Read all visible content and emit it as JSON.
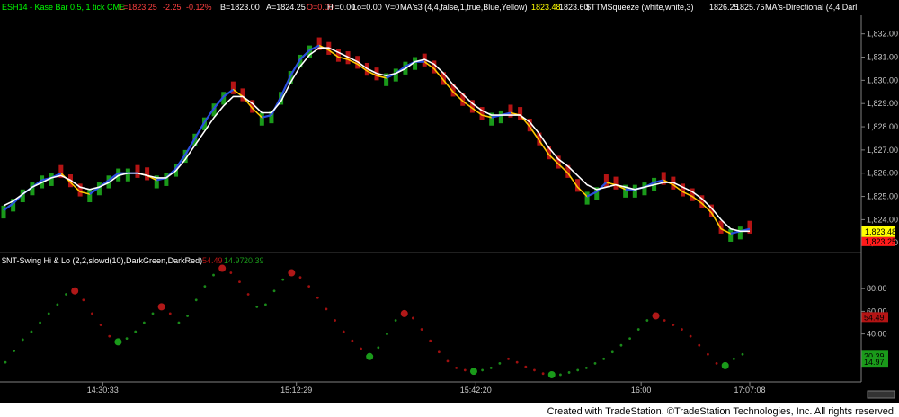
{
  "header": {
    "symbol": "ESH14 - Kase Bar 0.5, 1 tick  CME",
    "last": "L=1823.25",
    "change": "-2.25",
    "pct": "-0.12%",
    "bid": "B=1823.00",
    "ask": "A=1824.25",
    "open": "O=0.00",
    "hi": "Hi=0.00",
    "lo": "Lo=0.00",
    "vol": "V=0",
    "ma_label": "MA's3 (4,4,false,1,true,Blue,Yellow)",
    "ma_v1": "1823.48",
    "ma_v2": "1823.60",
    "ttm_label": "$TTMSqueeze (white,white,3)",
    "ttm_v1": "1826.25",
    "ttm_v2": "1825.75",
    "dir_label": "MA's-Directional (4,4,Darl"
  },
  "lower_header": {
    "label": "$NT-Swing Hi & Lo (2,2,slowd(10),DarkGreen,DarkRed)",
    "v1": "54.49",
    "v2": "14.97",
    "v3": "20.39"
  },
  "footer": {
    "credit": "Created with TradeStation. ©TradeStation Technologies, Inc. All rights reserved."
  },
  "colors": {
    "background": "#000000",
    "up_bar": "#1a9a1a",
    "down_bar": "#b41414",
    "ma_blue": "#2a4fe0",
    "ma_yellow": "#ffc800",
    "ttm_line": "#ffffff",
    "dot_green": "#1a8a1a",
    "dot_red": "#a01010",
    "price_tag": "#ffff00",
    "price_tag_red": "#ff1a1a"
  },
  "chart_data": [
    {
      "type": "candlestick",
      "title": "ESH14 - Kase Bar 0.5, 1 tick",
      "ylim": [
        1822.7,
        1832.8
      ],
      "yticks": [
        "1,832.00",
        "1,831.00",
        "1,830.00",
        "1,829.00",
        "1,828.00",
        "1,827.00",
        "1,826.00",
        "1,825.00",
        "1,824.00",
        "1,823.00"
      ],
      "xticks": [
        "14:30:33",
        "15:12:29",
        "15:42:20",
        "16:00",
        "17:07:08"
      ],
      "last_price_tags": [
        "1,823.48",
        "1,823.25"
      ],
      "series": [
        {
          "name": "MA's3 fast",
          "values": [
            1824.4,
            1824.7,
            1825.1,
            1825.4,
            1825.7,
            1825.8,
            1826.0,
            1825.6,
            1825.2,
            1825.1,
            1825.4,
            1825.7,
            1826.0,
            1826.0,
            1826.0,
            1825.9,
            1825.7,
            1825.8,
            1826.2,
            1826.8,
            1827.5,
            1828.2,
            1828.8,
            1829.3,
            1829.6,
            1829.3,
            1828.8,
            1828.4,
            1828.5,
            1829.3,
            1830.2,
            1830.9,
            1831.3,
            1831.5,
            1831.3,
            1831.0,
            1830.9,
            1830.7,
            1830.4,
            1830.2,
            1830.1,
            1830.3,
            1830.6,
            1830.8,
            1830.8,
            1830.5,
            1830.0,
            1829.5,
            1829.1,
            1828.8,
            1828.5,
            1828.4,
            1828.5,
            1828.6,
            1828.5,
            1828.0,
            1827.4,
            1826.8,
            1826.4,
            1826.0,
            1825.4,
            1825.0,
            1825.2,
            1825.6,
            1825.5,
            1825.3,
            1825.3,
            1825.4,
            1825.6,
            1825.7,
            1825.5,
            1825.2,
            1825.0,
            1824.7,
            1824.3,
            1823.6,
            1823.4,
            1823.5,
            1823.6
          ]
        },
        {
          "name": "TTMSqueeze",
          "values": [
            1824.6,
            1824.8,
            1825.1,
            1825.4,
            1825.6,
            1825.8,
            1825.9,
            1825.7,
            1825.4,
            1825.3,
            1825.4,
            1825.6,
            1825.9,
            1826.0,
            1826.0,
            1825.9,
            1825.8,
            1825.8,
            1826.1,
            1826.6,
            1827.2,
            1827.8,
            1828.4,
            1828.9,
            1829.3,
            1829.3,
            1829.0,
            1828.6,
            1828.6,
            1829.1,
            1829.9,
            1830.6,
            1831.1,
            1831.4,
            1831.4,
            1831.2,
            1831.0,
            1830.8,
            1830.5,
            1830.3,
            1830.2,
            1830.3,
            1830.5,
            1830.8,
            1830.9,
            1830.7,
            1830.3,
            1829.8,
            1829.4,
            1829.0,
            1828.7,
            1828.5,
            1828.5,
            1828.5,
            1828.5,
            1828.2,
            1827.7,
            1827.1,
            1826.6,
            1826.3,
            1825.9,
            1825.5,
            1825.3,
            1825.4,
            1825.5,
            1825.4,
            1825.3,
            1825.4,
            1825.5,
            1825.6,
            1825.6,
            1825.4,
            1825.2,
            1824.9,
            1824.5,
            1824.0,
            1823.6,
            1823.5,
            1823.5
          ]
        }
      ]
    },
    {
      "type": "scatter",
      "title": "$NT-Swing Hi & Lo (2,2,slowd(10),DarkGreen,DarkRed)",
      "ylim": [
        0,
        100
      ],
      "yticks": [
        "80.00",
        "60.00",
        "40.00",
        "20.00"
      ],
      "last_value_tags": [
        "54.49",
        "20.39",
        "14.97"
      ],
      "values": [
        15,
        25,
        35,
        42,
        50,
        58,
        66,
        75,
        78,
        70,
        58,
        48,
        38,
        33,
        36,
        42,
        50,
        58,
        64,
        58,
        50,
        56,
        70,
        82,
        92,
        98,
        94,
        86,
        75,
        64,
        66,
        78,
        88,
        94,
        90,
        82,
        72,
        62,
        52,
        42,
        34,
        27,
        20,
        28,
        40,
        52,
        58,
        54,
        44,
        34,
        24,
        16,
        10,
        8,
        7,
        8,
        10,
        14,
        18,
        15,
        11,
        8,
        5,
        4,
        4,
        6,
        8,
        10,
        14,
        18,
        24,
        30,
        36,
        44,
        52,
        56,
        52,
        48,
        44,
        38,
        30,
        22,
        14,
        12,
        18,
        22
      ],
      "swing_high_markers": [
        85,
        93,
        60,
        20,
        55
      ],
      "swing_low_markers": [
        34,
        38,
        65,
        7,
        4,
        4,
        12
      ]
    }
  ]
}
